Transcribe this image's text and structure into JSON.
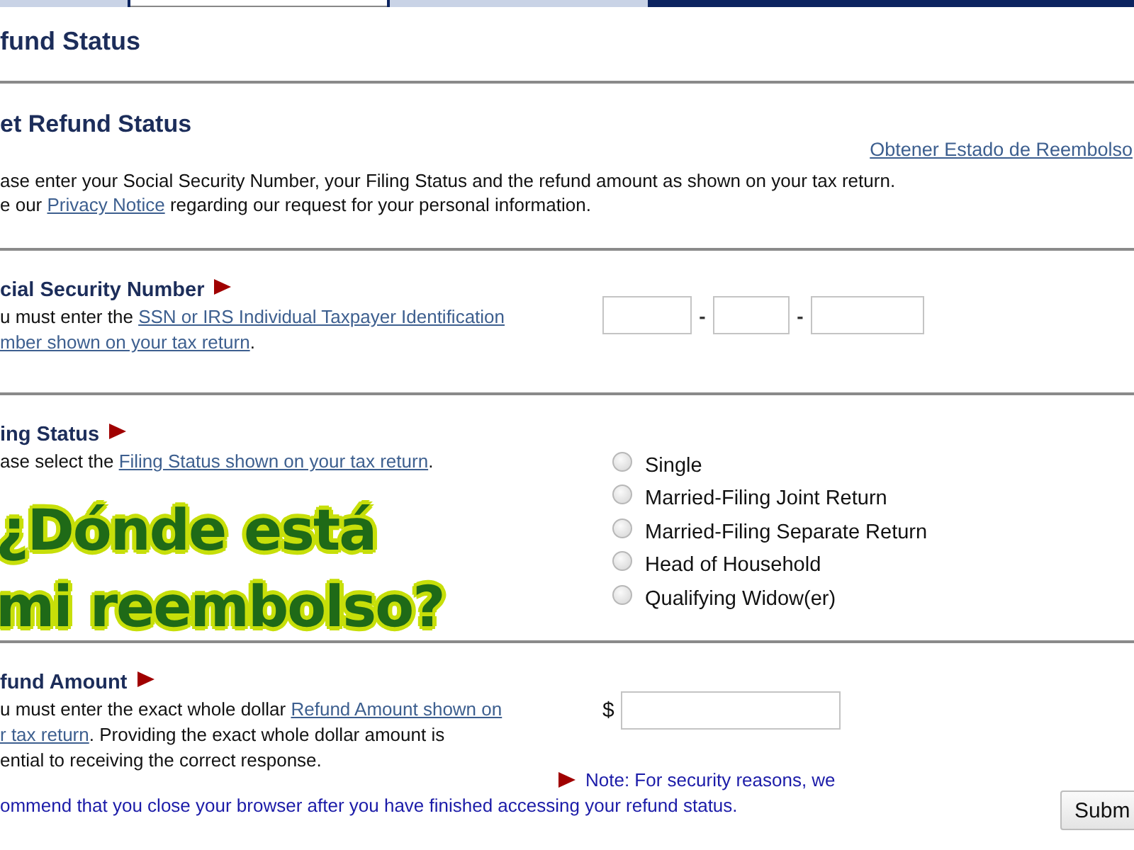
{
  "tabs": [
    {
      "selected": false
    },
    {
      "selected": true
    },
    {
      "selected": false
    }
  ],
  "page_title": "fund Status",
  "intro": {
    "heading": "et Refund Status",
    "spanish_link": "Obtener Estado de Reembolso",
    "lines": [
      [
        {
          "text": "ase enter your Social Security Number, your Filing Status and the refund amount as shown on your tax return."
        }
      ],
      [
        {
          "text": "e our "
        },
        {
          "text": "Privacy Notice",
          "link": true
        },
        {
          "text": " regarding our request for your personal information."
        }
      ]
    ]
  },
  "ssn": {
    "heading": "cial Security Number",
    "lines": [
      [
        {
          "text": "u must enter the "
        },
        {
          "text": "SSN or IRS Individual Taxpayer Identification",
          "link": true
        }
      ],
      [
        {
          "text": "mber shown on your tax return",
          "link": true
        },
        {
          "text": "."
        }
      ]
    ],
    "separators": [
      "-",
      "-"
    ]
  },
  "filing_status": {
    "heading": "ing Status",
    "lines": [
      [
        {
          "text": "ase select the "
        },
        {
          "text": "Filing Status shown on your tax return",
          "link": true
        },
        {
          "text": "."
        }
      ]
    ],
    "options": [
      {
        "label": "Single",
        "selected": false
      },
      {
        "label": "Married-Filing Joint Return",
        "selected": false
      },
      {
        "label": "Married-Filing Separate Return",
        "selected": false
      },
      {
        "label": "Head of Household",
        "selected": false
      },
      {
        "label": "Qualifying Widow(er)",
        "selected": false
      }
    ]
  },
  "refund_amount": {
    "heading": "fund Amount",
    "lines": [
      [
        {
          "text": "u must enter the exact whole dollar "
        },
        {
          "text": "Refund Amount shown on",
          "link": true
        }
      ],
      [
        {
          "text": "r tax return",
          "link": true
        },
        {
          "text": ". Providing the exact whole dollar amount is"
        }
      ],
      [
        {
          "text": "ential to receiving the correct response."
        }
      ]
    ],
    "currency": "$"
  },
  "note": {
    "lines": [
      "Note: For security reasons, we",
      "ommend that you close your browser after you have finished accessing your refund status."
    ]
  },
  "submit_button": "Subm",
  "overlay_title": [
    "¿Dónde está",
    "mi reembolso?"
  ]
}
